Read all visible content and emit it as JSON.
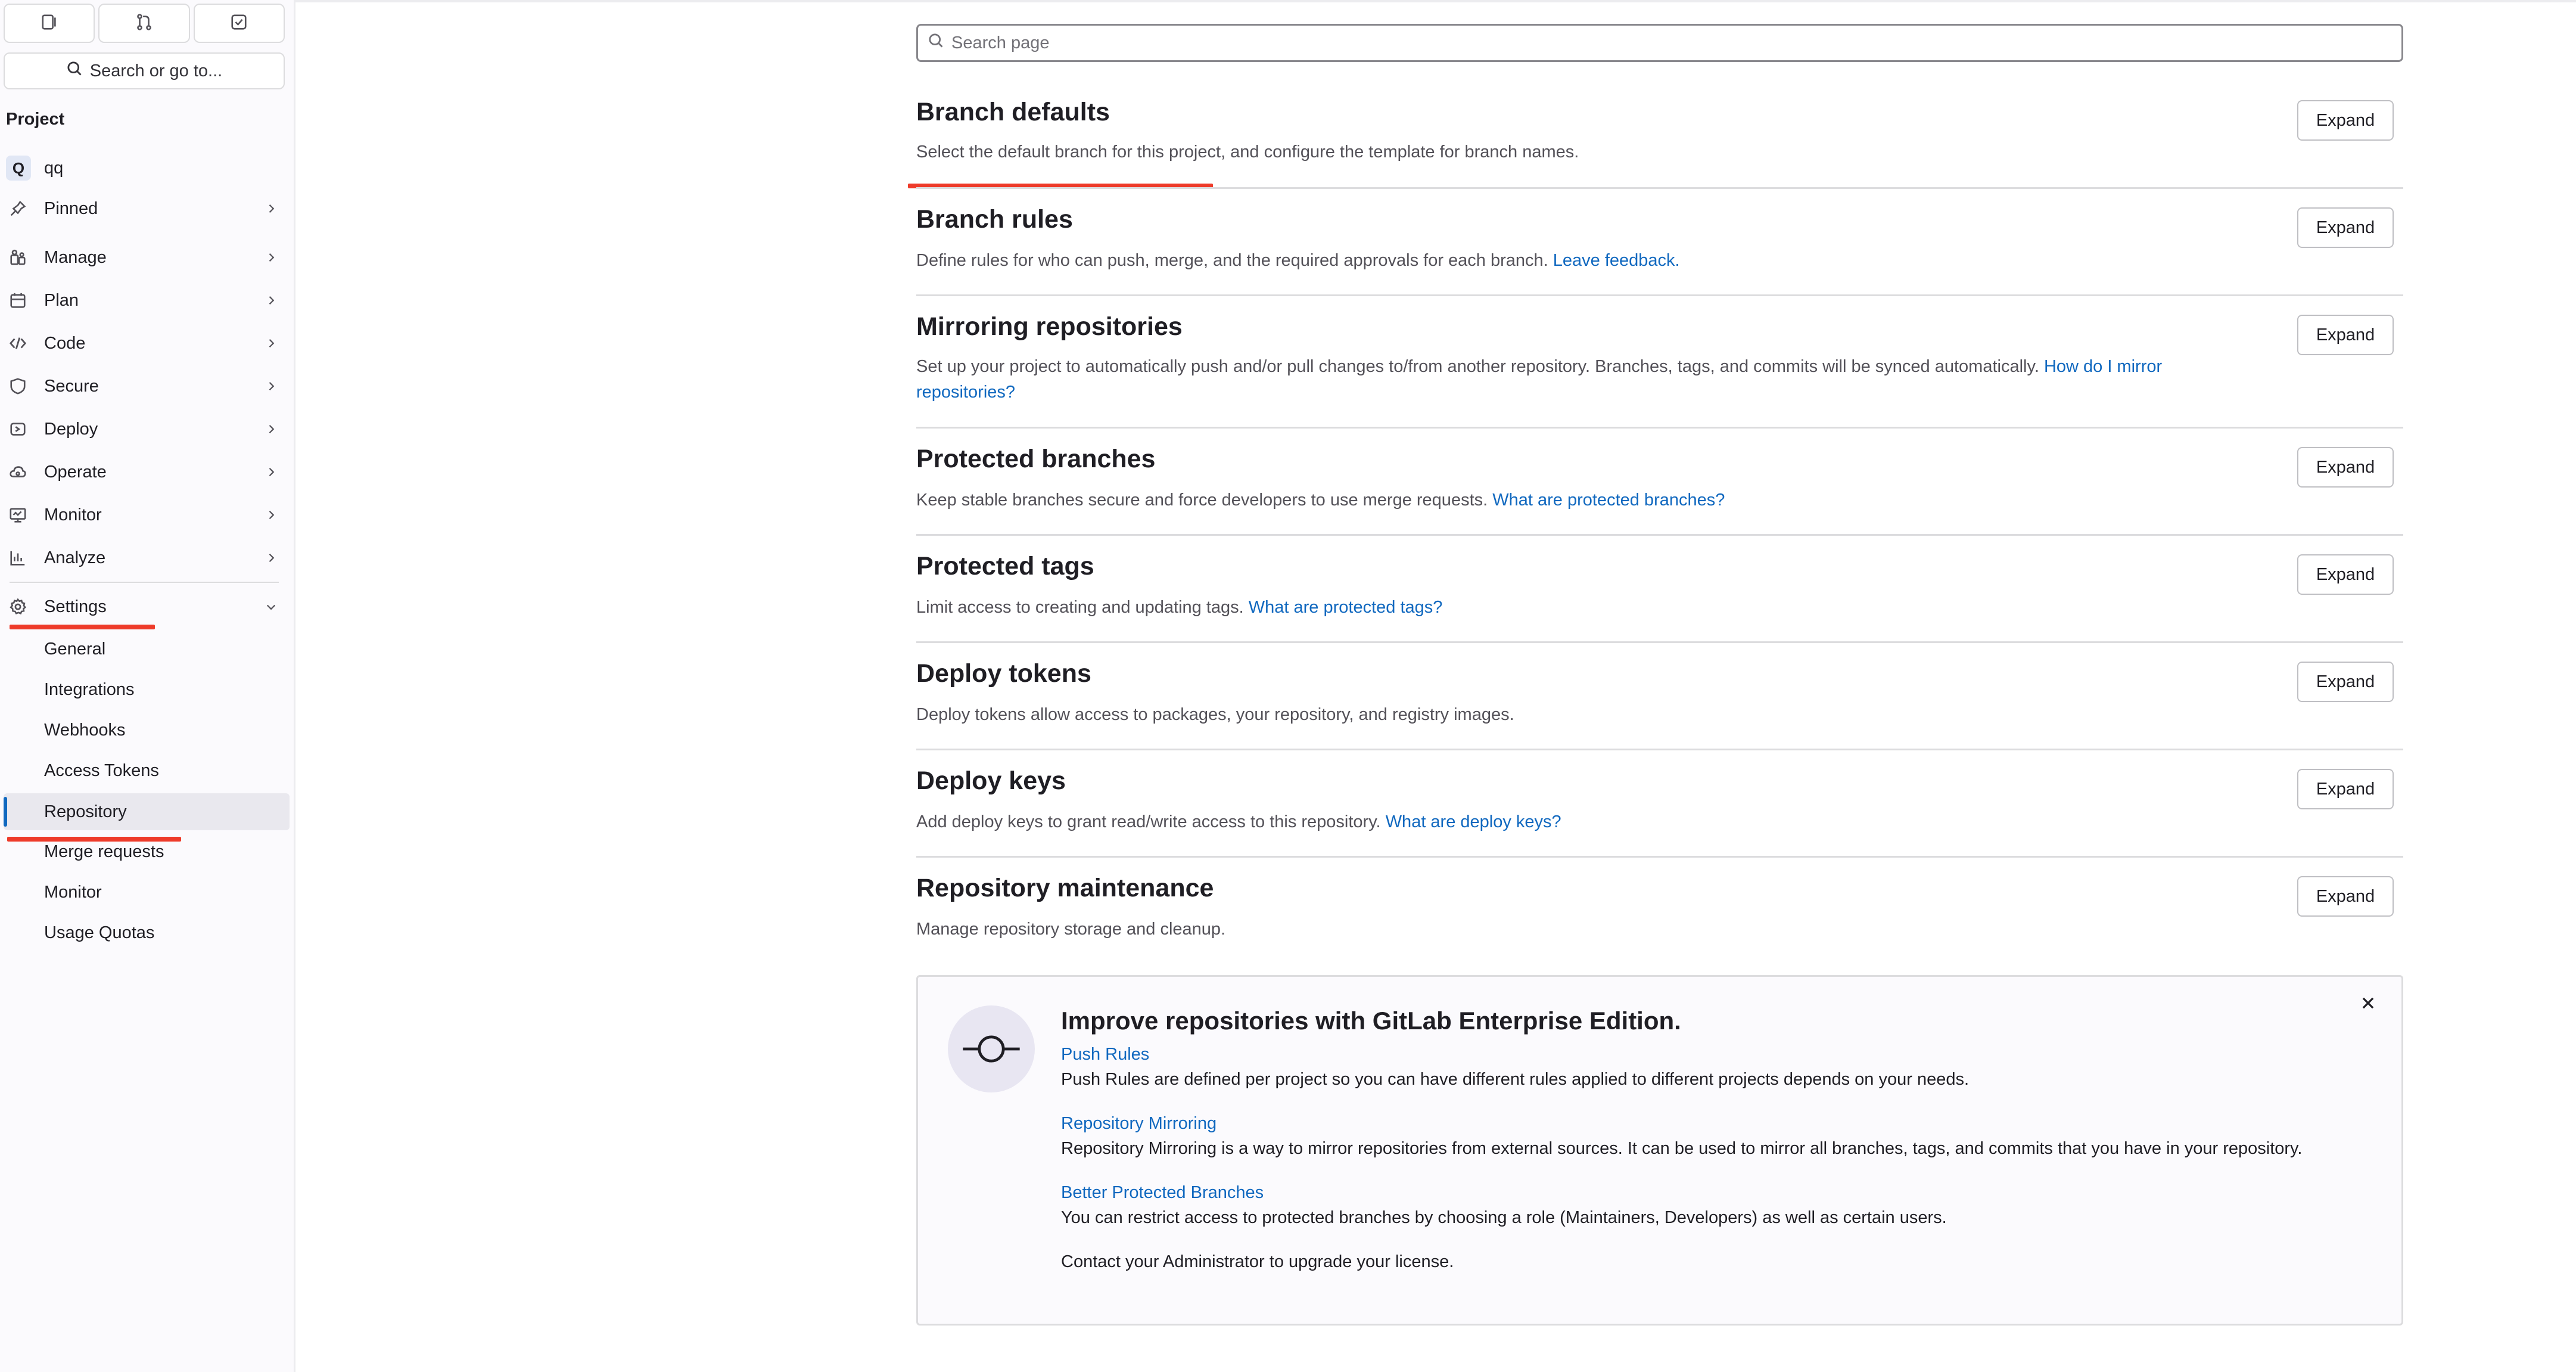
{
  "sidebar": {
    "top_buttons": [
      {
        "icon": "issues-icon"
      },
      {
        "icon": "merge-request-icon"
      },
      {
        "icon": "todo-icon"
      }
    ],
    "search_label": "Search or go to...",
    "section_heading": "Project",
    "project": {
      "avatar_letter": "Q",
      "name": "qq"
    },
    "nav_items": [
      {
        "label": "Pinned",
        "icon": "pin-icon"
      },
      {
        "label": "Manage",
        "icon": "users-icon"
      },
      {
        "label": "Plan",
        "icon": "calendar-icon"
      },
      {
        "label": "Code",
        "icon": "code-icon"
      },
      {
        "label": "Secure",
        "icon": "shield-icon"
      },
      {
        "label": "Deploy",
        "icon": "deploy-icon"
      },
      {
        "label": "Operate",
        "icon": "cloud-icon"
      },
      {
        "label": "Monitor",
        "icon": "monitor-icon"
      },
      {
        "label": "Analyze",
        "icon": "chart-icon"
      },
      {
        "label": "Settings",
        "icon": "gear-icon",
        "expanded": true
      }
    ],
    "settings_items": [
      {
        "label": "General"
      },
      {
        "label": "Integrations"
      },
      {
        "label": "Webhooks"
      },
      {
        "label": "Access Tokens"
      },
      {
        "label": "Repository",
        "active": true
      },
      {
        "label": "Merge requests"
      },
      {
        "label": "Monitor"
      },
      {
        "label": "Usage Quotas"
      }
    ]
  },
  "main": {
    "search_placeholder": "Search page",
    "expand_label": "Expand",
    "sections": [
      {
        "title": "Branch defaults",
        "desc": "Select the default branch for this project, and configure the template for branch names.",
        "link": ""
      },
      {
        "title": "Branch rules",
        "desc": "Define rules for who can push, merge, and the required approvals for each branch. ",
        "link": "Leave feedback."
      },
      {
        "title": "Mirroring repositories",
        "desc": "Set up your project to automatically push and/or pull changes to/from another repository. Branches, tags, and commits will be synced automatically. ",
        "link": "How do I mirror repositories?"
      },
      {
        "title": "Protected branches",
        "desc": "Keep stable branches secure and force developers to use merge requests. ",
        "link": "What are protected branches?"
      },
      {
        "title": "Protected tags",
        "desc": "Limit access to creating and updating tags. ",
        "link": "What are protected tags?"
      },
      {
        "title": "Deploy tokens",
        "desc": "Deploy tokens allow access to packages, your repository, and registry images.",
        "link": ""
      },
      {
        "title": "Deploy keys",
        "desc": "Add deploy keys to grant read/write access to this repository. ",
        "link": "What are deploy keys?"
      },
      {
        "title": "Repository maintenance",
        "desc": "Manage repository storage and cleanup.",
        "link": ""
      }
    ],
    "promo": {
      "title": "Improve repositories with GitLab Enterprise Edition.",
      "features": [
        {
          "link": "Push Rules",
          "text": "Push Rules are defined per project so you can have different rules applied to different projects depends on your needs."
        },
        {
          "link": "Repository Mirroring",
          "text": "Repository Mirroring is a way to mirror repositories from external sources. It can be used to mirror all branches, tags, and commits that you have in your repository."
        },
        {
          "link": "Better Protected Branches",
          "text": "You can restrict access to protected branches by choosing a role (Maintainers, Developers) as well as certain users."
        }
      ],
      "footer": "Contact your Administrator to upgrade your license."
    }
  },
  "colors": {
    "link": "#1068bf",
    "annotation_red": "#ee3b2a",
    "active_bar": "#1068bf"
  }
}
